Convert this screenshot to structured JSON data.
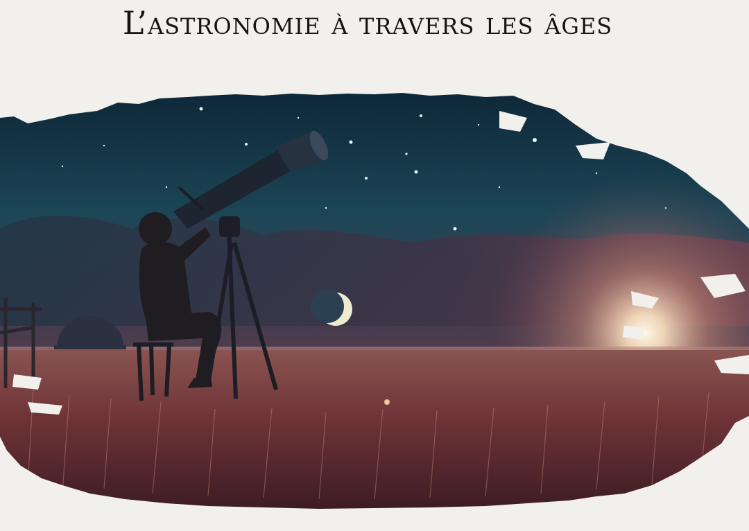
{
  "header": {
    "title": "L’astronomie à travers les âges"
  },
  "illustration": {
    "subject": "child-looking-through-telescope",
    "colors": {
      "sky_top": "#0f2a3d",
      "sky_mid": "#1f4a5a",
      "horizon_glow": "#f4d9b6",
      "grass": "#7a3b3a",
      "silhouette": "#1a1a22",
      "page_background": "#f1f0ec"
    }
  }
}
